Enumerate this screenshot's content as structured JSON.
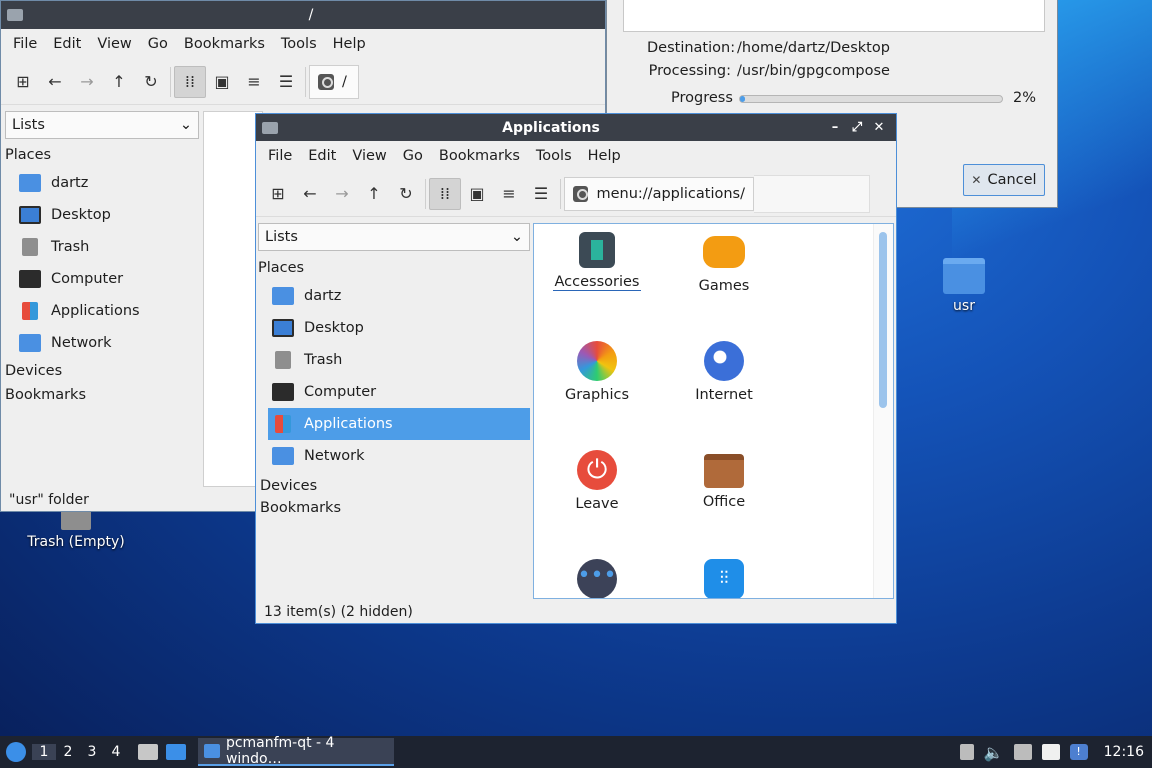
{
  "desktop": {
    "trash_label": "Trash (Empty)",
    "usr_label": "usr"
  },
  "back_window": {
    "title": "/",
    "menu": [
      "File",
      "Edit",
      "View",
      "Go",
      "Bookmarks",
      "Tools",
      "Help"
    ],
    "path": "/",
    "combo": "Lists",
    "places_header": "Places",
    "places": [
      "dartz",
      "Desktop",
      "Trash",
      "Computer",
      "Applications",
      "Network"
    ],
    "devices": "Devices",
    "bookmarks": "Bookmarks",
    "status": "\"usr\" folder"
  },
  "progress_dialog": {
    "destination_label": "Destination:",
    "destination_value": "/home/dartz/Desktop",
    "processing_label": "Processing:",
    "processing_value": "/usr/bin/gpgcompose",
    "progress_label": "Progress",
    "progress_percent": "2%",
    "progress_fraction": 0.02,
    "cancel_label": "Cancel"
  },
  "front_window": {
    "title": "Applications",
    "menu": [
      "File",
      "Edit",
      "View",
      "Go",
      "Bookmarks",
      "Tools",
      "Help"
    ],
    "path": "menu://applications/",
    "combo": "Lists",
    "places_header": "Places",
    "places": [
      "dartz",
      "Desktop",
      "Trash",
      "Computer",
      "Applications",
      "Network"
    ],
    "selected_place": "Applications",
    "devices": "Devices",
    "bookmarks": "Bookmarks",
    "status": "13 item(s) (2 hidden)",
    "apps": [
      "Accessories",
      "Games",
      "Graphics",
      "Internet",
      "Leave",
      "Office"
    ]
  },
  "taskbar": {
    "workspaces": [
      "1",
      "2",
      "3",
      "4"
    ],
    "task_label": "pcmanfm-qt - 4 windo…",
    "clock": "12:16"
  }
}
